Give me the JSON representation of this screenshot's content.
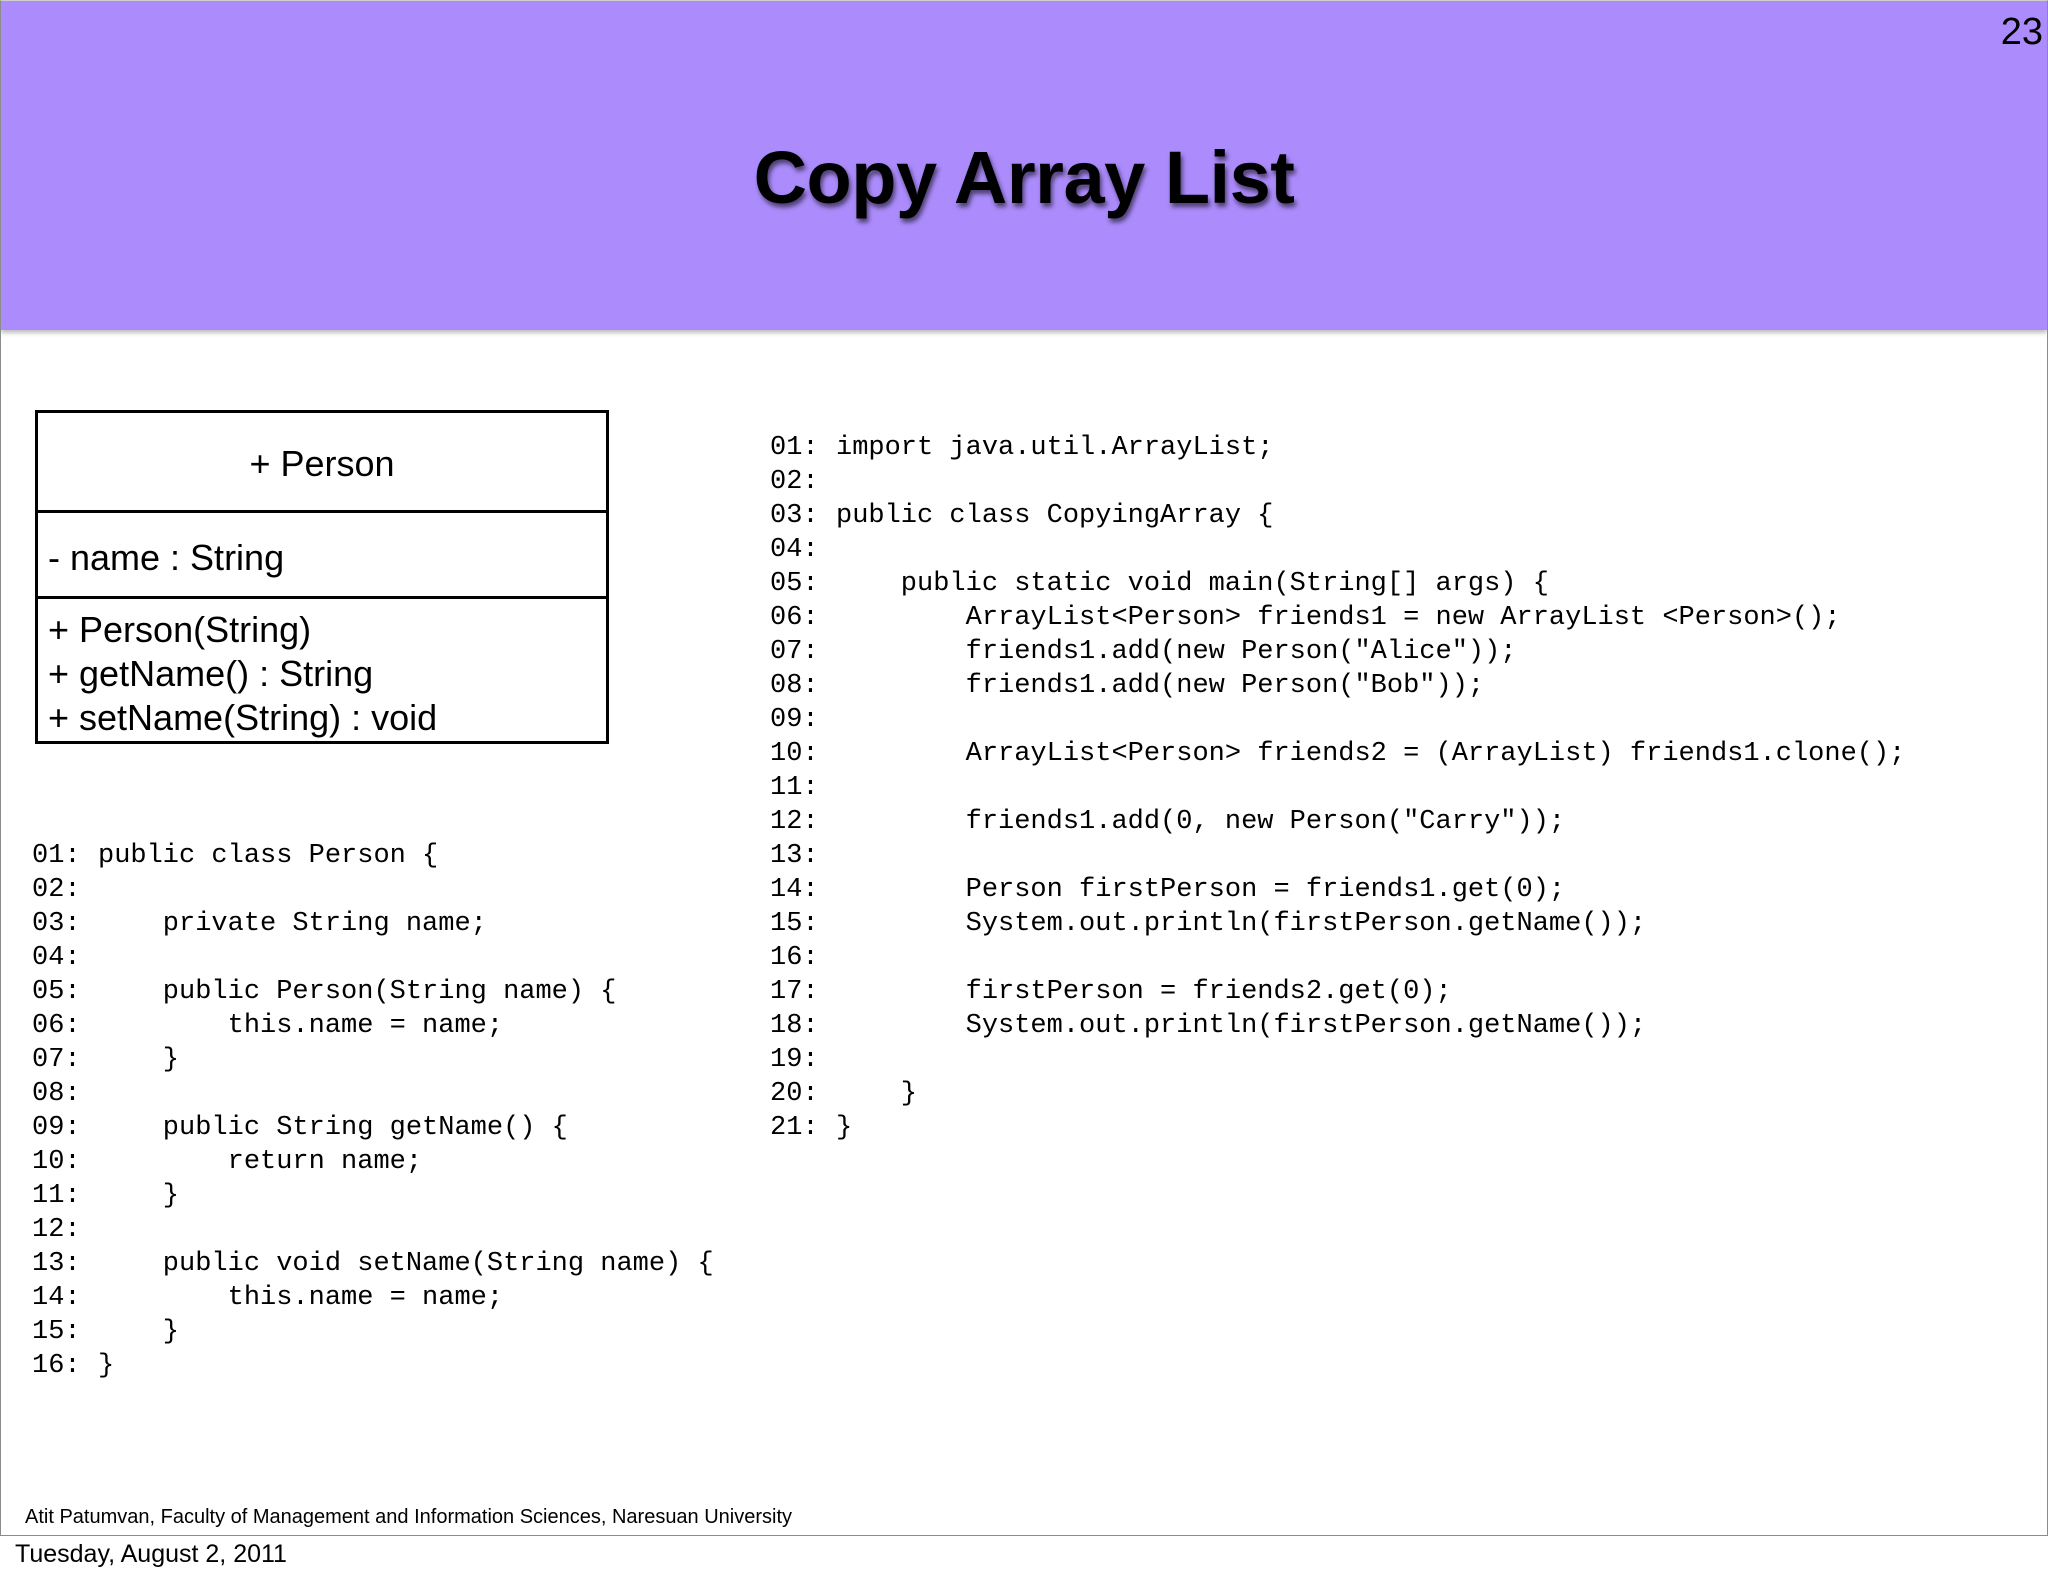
{
  "slide": {
    "title": "Copy Array List",
    "number": "23",
    "header_color": "#ac8cfc"
  },
  "uml": {
    "class_name": "+ Person",
    "attributes": [
      "- name : String"
    ],
    "operations": [
      "+ Person(String)",
      "+ getName() : String",
      "+ setName(String) : void"
    ]
  },
  "code_person": [
    {
      "ln": "01:",
      "text": "public class Person {"
    },
    {
      "ln": "02:",
      "text": ""
    },
    {
      "ln": "03:",
      "text": "    private String name;"
    },
    {
      "ln": "04:",
      "text": ""
    },
    {
      "ln": "05:",
      "text": "    public Person(String name) {"
    },
    {
      "ln": "06:",
      "text": "        this.name = name;"
    },
    {
      "ln": "07:",
      "text": "    }"
    },
    {
      "ln": "08:",
      "text": ""
    },
    {
      "ln": "09:",
      "text": "    public String getName() {"
    },
    {
      "ln": "10:",
      "text": "        return name;"
    },
    {
      "ln": "11:",
      "text": "    }"
    },
    {
      "ln": "12:",
      "text": ""
    },
    {
      "ln": "13:",
      "text": "    public void setName(String name) {"
    },
    {
      "ln": "14:",
      "text": "        this.name = name;"
    },
    {
      "ln": "15:",
      "text": "    }"
    },
    {
      "ln": "16:",
      "text": "}"
    }
  ],
  "code_copying": [
    {
      "ln": "01:",
      "text": "import java.util.ArrayList;"
    },
    {
      "ln": "02:",
      "text": ""
    },
    {
      "ln": "03:",
      "text": "public class CopyingArray {"
    },
    {
      "ln": "04:",
      "text": ""
    },
    {
      "ln": "05:",
      "text": "    public static void main(String[] args) {"
    },
    {
      "ln": "06:",
      "text": "        ArrayList<Person> friends1 = new ArrayList <Person>();"
    },
    {
      "ln": "07:",
      "text": "        friends1.add(new Person(\"Alice\"));"
    },
    {
      "ln": "08:",
      "text": "        friends1.add(new Person(\"Bob\"));"
    },
    {
      "ln": "09:",
      "text": ""
    },
    {
      "ln": "10:",
      "text": "        ArrayList<Person> friends2 = (ArrayList) friends1.clone();"
    },
    {
      "ln": "11:",
      "text": ""
    },
    {
      "ln": "12:",
      "text": "        friends1.add(0, new Person(\"Carry\"));"
    },
    {
      "ln": "13:",
      "text": ""
    },
    {
      "ln": "14:",
      "text": "        Person firstPerson = friends1.get(0);"
    },
    {
      "ln": "15:",
      "text": "        System.out.println(firstPerson.getName());"
    },
    {
      "ln": "16:",
      "text": ""
    },
    {
      "ln": "17:",
      "text": "        firstPerson = friends2.get(0);"
    },
    {
      "ln": "18:",
      "text": "        System.out.println(firstPerson.getName());"
    },
    {
      "ln": "19:",
      "text": ""
    },
    {
      "ln": "20:",
      "text": "    }"
    },
    {
      "ln": "21:",
      "text": "}"
    }
  ],
  "footer": {
    "credit": "Atit Patumvan, Faculty of Management and Information Sciences, Naresuan University",
    "date": "Tuesday, August 2, 2011"
  }
}
